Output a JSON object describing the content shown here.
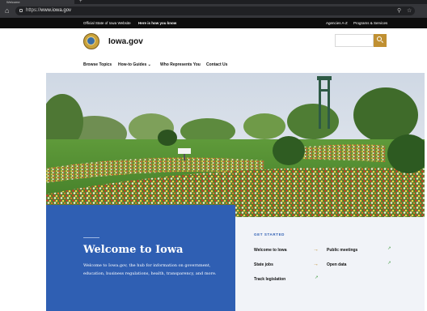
{
  "browser": {
    "tab_title": "Welcome",
    "new_tab_glyph": "+",
    "url_scheme": "https://",
    "url_host": "www.iowa.gov",
    "icons": [
      "home-icon",
      "lock-icon",
      "search-icon",
      "star-icon"
    ]
  },
  "utility_bar": {
    "official_text": "Official State of Iowa Website",
    "how_you_know": "Here is how you know",
    "agencies": "Agencies A-Z",
    "programs": "Programs & Services"
  },
  "header": {
    "site_name": "Iowa.gov",
    "search_placeholder": ""
  },
  "nav": {
    "browse": "Browse Topics",
    "howto": "How-to Guides",
    "howto_caret": "⌄",
    "represents": "Who Represents You",
    "contact": "Contact Us"
  },
  "welcome": {
    "title": "Welcome to Iowa",
    "description": "Welcome to Iowa.gov, the hub for information on government, education, business regulations, health, transparency, and more."
  },
  "get_started": {
    "label": "GET STARTED",
    "links": [
      {
        "label": "Welcome to Iowa",
        "type": "internal"
      },
      {
        "label": "Public meetings",
        "type": "external"
      },
      {
        "label": "State jobs",
        "type": "internal"
      },
      {
        "label": "Open data",
        "type": "external"
      },
      {
        "label": "Track legislation",
        "type": "external"
      }
    ],
    "arrow_glyph": "→",
    "external_glyph": "↗"
  },
  "colors": {
    "brand_blue": "#2f5fb3",
    "brand_gold": "#c09032",
    "utility_bar": "#0d0d0d"
  }
}
